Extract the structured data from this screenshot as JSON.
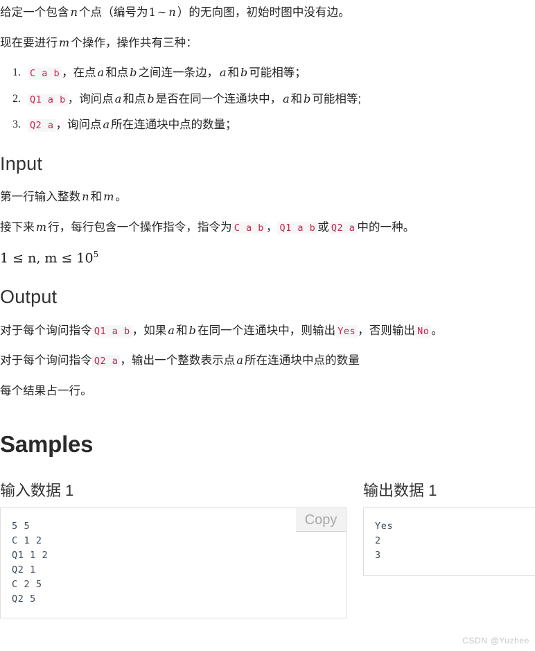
{
  "intro": {
    "line1_a": "给定一个包含",
    "line1_n": "n",
    "line1_b": "个点（编号为",
    "line1_one": "1",
    "line1_tilde": "∼",
    "line1_n2": "n",
    "line1_c": "）的无向图，初始时图中没有边。",
    "line2_a": "现在要进行",
    "line2_m": "m",
    "line2_b": "个操作，操作共有三种："
  },
  "operations": [
    {
      "code": "C a b",
      "text_a": "，在点",
      "var1": "a",
      "text_b": "和点",
      "var2": "b",
      "text_c": "之间连一条边，",
      "var3": "a",
      "text_d": "和",
      "var4": "b",
      "text_e": "可能相等；"
    },
    {
      "code": "Q1 a b",
      "text_a": "，询问点",
      "var1": "a",
      "text_b": "和点",
      "var2": "b",
      "text_c": "是否在同一个连通块中，",
      "var3": "a",
      "text_d": "和",
      "var4": "b",
      "text_e": "可能相等;"
    },
    {
      "code": "Q2 a",
      "text_a": "，询问点",
      "var1": "a",
      "text_b": "所在连通块中点的数量；"
    }
  ],
  "input_section": {
    "heading": "Input",
    "p1_a": "第一行输入整数",
    "p1_n": "n",
    "p1_b": "和",
    "p1_m": "m",
    "p1_c": "。",
    "p2_a": "接下来",
    "p2_m": "m",
    "p2_b": "行，每行包含一个操作指令，指令为",
    "p2_code1": "C a b",
    "p2_c": "，",
    "p2_code2": "Q1 a b",
    "p2_d": "或",
    "p2_code3": "Q2 a",
    "p2_e": "中的一种。",
    "constraint_pre": "1 ≤ n, m ≤ 10",
    "constraint_sup": "5"
  },
  "output_section": {
    "heading": "Output",
    "p1_a": "对于每个询问指令",
    "p1_code": "Q1 a b",
    "p1_b": "，如果",
    "p1_var1": "a",
    "p1_c": "和",
    "p1_var2": "b",
    "p1_d": "在同一个连通块中，则输出",
    "p1_yes": "Yes",
    "p1_e": "，否则输出",
    "p1_no": "No",
    "p1_f": "。",
    "p2_a": "对于每个询问指令",
    "p2_code": "Q2 a",
    "p2_b": "，输出一个整数表示点",
    "p2_var": "a",
    "p2_c": "所在连通块中点的数量",
    "p3": "每个结果占一行。"
  },
  "samples": {
    "heading": "Samples",
    "input_label": "输入数据 1",
    "output_label": "输出数据 1",
    "copy_label": "Copy",
    "input_code": "5 5\nC 1 2\nQ1 1 2\nQ2 1\nC 2 5\nQ2 5",
    "output_code": "Yes\n2\n3"
  },
  "watermark": "CSDN @Yuzhee",
  "colors": {
    "inline_code": "#c7254e",
    "inline_code_bg": "#f6f6f6",
    "heading": "#333333",
    "body_text": "#262626",
    "code_text": "#3b4a5a",
    "border": "#dddddd",
    "copy_bg": "#f2f2f2",
    "watermark": "#c6c6c6"
  }
}
